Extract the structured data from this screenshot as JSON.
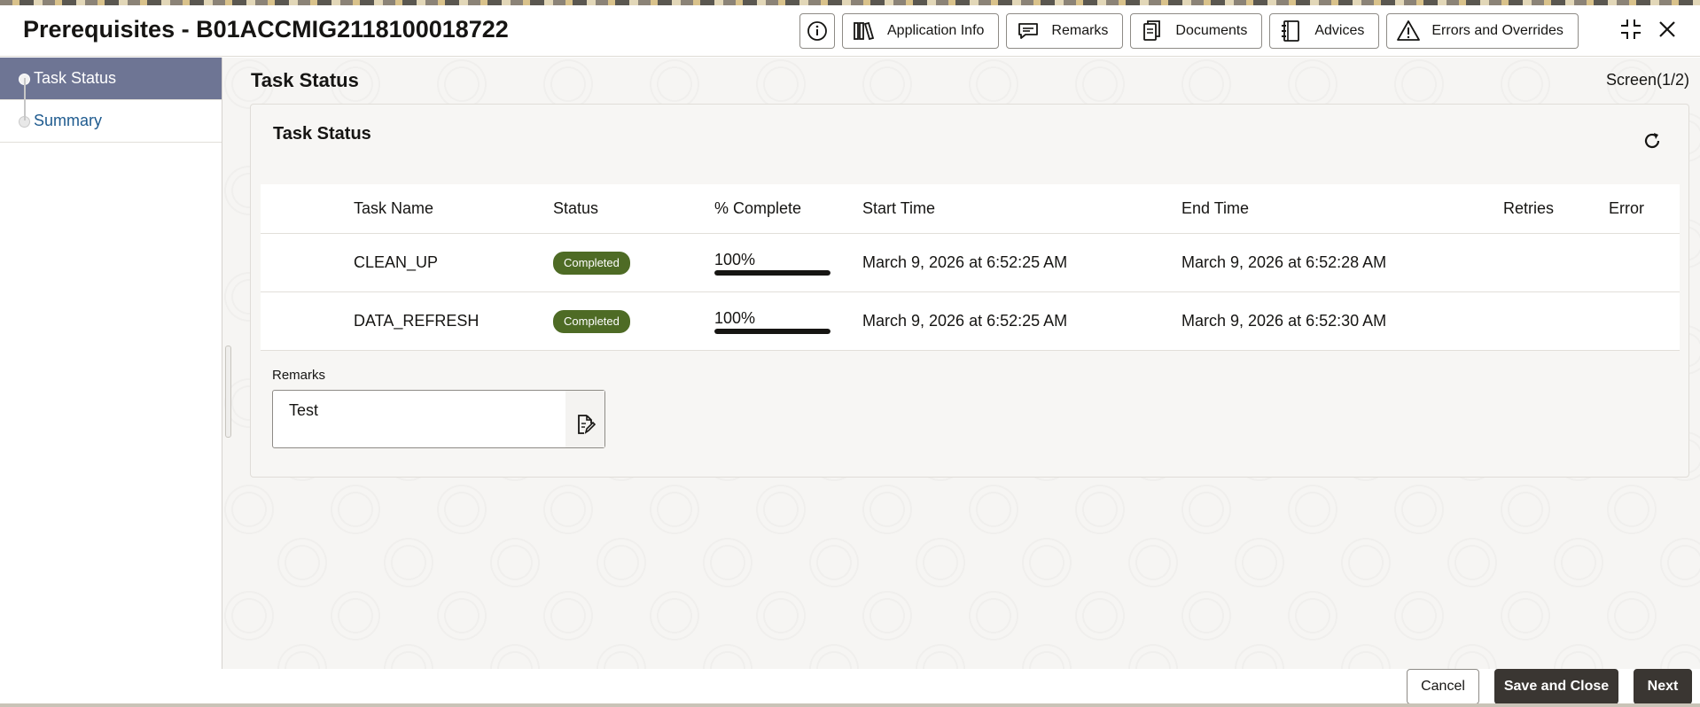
{
  "header": {
    "title": "Prerequisites - B01ACCMIG2118100018722",
    "buttons": {
      "application_info": "Application Info",
      "remarks": "Remarks",
      "documents": "Documents",
      "advices": "Advices",
      "errors_overrides": "Errors and Overrides"
    },
    "icons": [
      "info-icon",
      "application-info-icon",
      "remarks-chat-icon",
      "documents-icon",
      "advices-icon",
      "warning-icon",
      "minimize-icon",
      "close-icon"
    ]
  },
  "sidebar": {
    "items": [
      {
        "label": "Task Status",
        "active": true
      },
      {
        "label": "Summary",
        "active": false
      }
    ]
  },
  "main": {
    "title": "Task Status",
    "screen_indicator": "Screen(1/2)",
    "panel_title": "Task Status",
    "table": {
      "columns": {
        "task_name": "Task Name",
        "status": "Status",
        "complete": "% Complete",
        "start_time": "Start Time",
        "end_time": "End Time",
        "retries": "Retries",
        "error": "Error"
      },
      "rows": [
        {
          "task_name": "CLEAN_UP",
          "status": "Completed",
          "complete_text": "100%",
          "complete": 100,
          "start_time": "March 9, 2026 at 6:52:25 AM",
          "end_time": "March 9, 2026 at 6:52:28 AM",
          "retries": "",
          "error": ""
        },
        {
          "task_name": "DATA_REFRESH",
          "status": "Completed",
          "complete_text": "100%",
          "complete": 100,
          "start_time": "March 9, 2026 at 6:52:25 AM",
          "end_time": "March 9, 2026 at 6:52:30 AM",
          "retries": "",
          "error": ""
        }
      ]
    },
    "remarks": {
      "label": "Remarks",
      "value": "Test"
    }
  },
  "footer": {
    "cancel": "Cancel",
    "save_close": "Save and Close",
    "next": "Next"
  },
  "colors": {
    "sidebar_active": "#6e7594",
    "status_completed": "#4e6b25",
    "primary_button": "#3a3632",
    "link": "#1f5b8f"
  }
}
